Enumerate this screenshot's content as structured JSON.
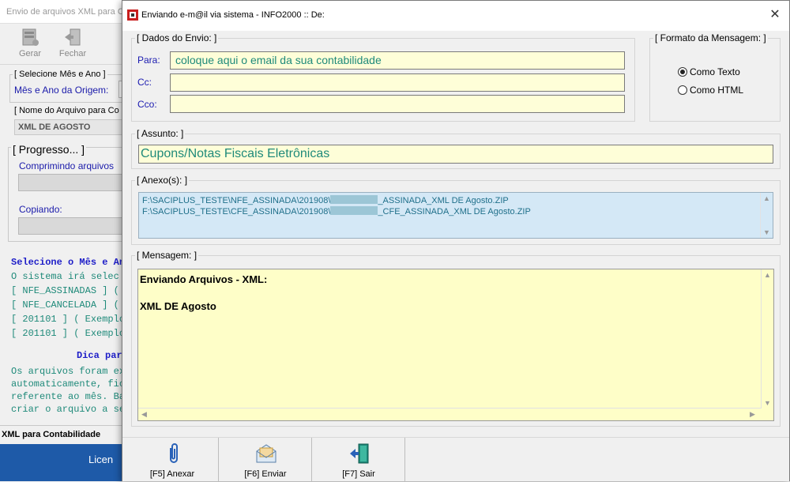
{
  "background_window": {
    "title": "Envio de arquivos XML para Co",
    "toolbar": {
      "gerar_label": "Gerar",
      "fechar_label": "Fechar"
    },
    "selecione_group_label": "[ Selecione Mês e Ano ]",
    "mes_ano_label": "Mês e Ano da Origem:",
    "nome_arquivo_group_label": "[ Nome do Arquivo para Co",
    "nome_arquivo_value": "XML DE AGOSTO",
    "progresso_label": "[ Progresso... ]",
    "comprimindo_label": "Comprimindo arquivos",
    "copiando_label": "Copiando:",
    "info_lines": [
      "Selecione o Mês e An",
      "O sistema irá selec",
      "[ NFE_ASSINADAS ] (",
      "[ NFE_CANCELADA ] (",
      "[ 201101 ] ( Exemplo",
      "[ 201101 ] ( Exemplo"
    ],
    "dica_line": "Dica par",
    "bottom_lines": [
      "Os arquivos foram ex",
      "automaticamente, fic",
      "referente ao mês. Ba",
      "criar o arquivo a se"
    ],
    "status_text": "XML para Contabilidade",
    "bluebar_text": "Licen"
  },
  "dialog": {
    "title": "Enviando e-m@il via sistema - INFO2000 :: De:",
    "close_glyph": "✕",
    "dados_envio": {
      "group_label": "[ Dados do Envio: ]",
      "para_label": "Para:",
      "para_value": "coloque aqui o email da sua contabilidade",
      "cc_label": "Cc:",
      "cc_value": "",
      "cco_label": "Cco:",
      "cco_value": ""
    },
    "formato": {
      "group_label": "[ Formato da Mensagem: ]",
      "options": [
        "Como Texto",
        "Como HTML"
      ],
      "selected": "Como Texto"
    },
    "assunto": {
      "group_label": "[ Assunto: ]",
      "value": "Cupons/Notas Fiscais Eletrônicas"
    },
    "anexos": {
      "group_label": "[ Anexo(s): ]",
      "items": [
        {
          "prefix": "F:\\SACIPLUS_TESTE\\NFE_ASSINADA\\201908\\",
          "suffix": "_ASSINADA_XML DE Agosto.ZIP"
        },
        {
          "prefix": "F:\\SACIPLUS_TESTE\\CFE_ASSINADA\\201908\\",
          "suffix": "_CFE_ASSINADA_XML DE Agosto.ZIP"
        }
      ]
    },
    "mensagem": {
      "group_label": "[ Mensagem: ]",
      "text": "Enviando Arquivos - XML:\n\nXML DE Agosto"
    },
    "buttons": {
      "anexar_label": "[F5] Anexar",
      "enviar_label": "[F6] Enviar",
      "sair_label": "[F7] Sair"
    },
    "colors": {
      "field_bg": "#fefed8",
      "message_bg": "#fefec8",
      "attach_bg": "#d4e8f6",
      "label_blue": "#1a1ab0",
      "value_teal": "#1f8a7a"
    }
  }
}
